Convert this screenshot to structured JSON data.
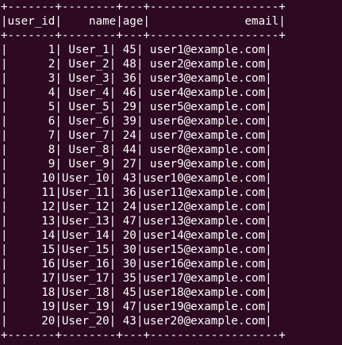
{
  "terminal": {
    "background": "#2d0922",
    "foreground": "#ffffff",
    "border": "+-------+--------+---+-------------------+",
    "header": "|user_id|    name|age|              email|",
    "rows": [
      "|      1| User_1| 45| user1@example.com|",
      "|      2| User_2| 48| user2@example.com|",
      "|      3| User_3| 36| user3@example.com|",
      "|      4| User_4| 46| user4@example.com|",
      "|      5| User_5| 29| user5@example.com|",
      "|      6| User_6| 39| user6@example.com|",
      "|      7| User_7| 24| user7@example.com|",
      "|      8| User_8| 44| user8@example.com|",
      "|      9| User_9| 27| user9@example.com|",
      "|     10|User_10| 43|user10@example.com|",
      "|     11|User_11| 36|user11@example.com|",
      "|     12|User_12| 24|user12@example.com|",
      "|     13|User_13| 47|user13@example.com|",
      "|     14|User_14| 20|user14@example.com|",
      "|     15|User_15| 30|user15@example.com|",
      "|     16|User_16| 30|user16@example.com|",
      "|     17|User_17| 35|user17@example.com|",
      "|     18|User_18| 45|user18@example.com|",
      "|     19|User_19| 47|user19@example.com|",
      "|     20|User_20| 43|user20@example.com|"
    ]
  }
}
